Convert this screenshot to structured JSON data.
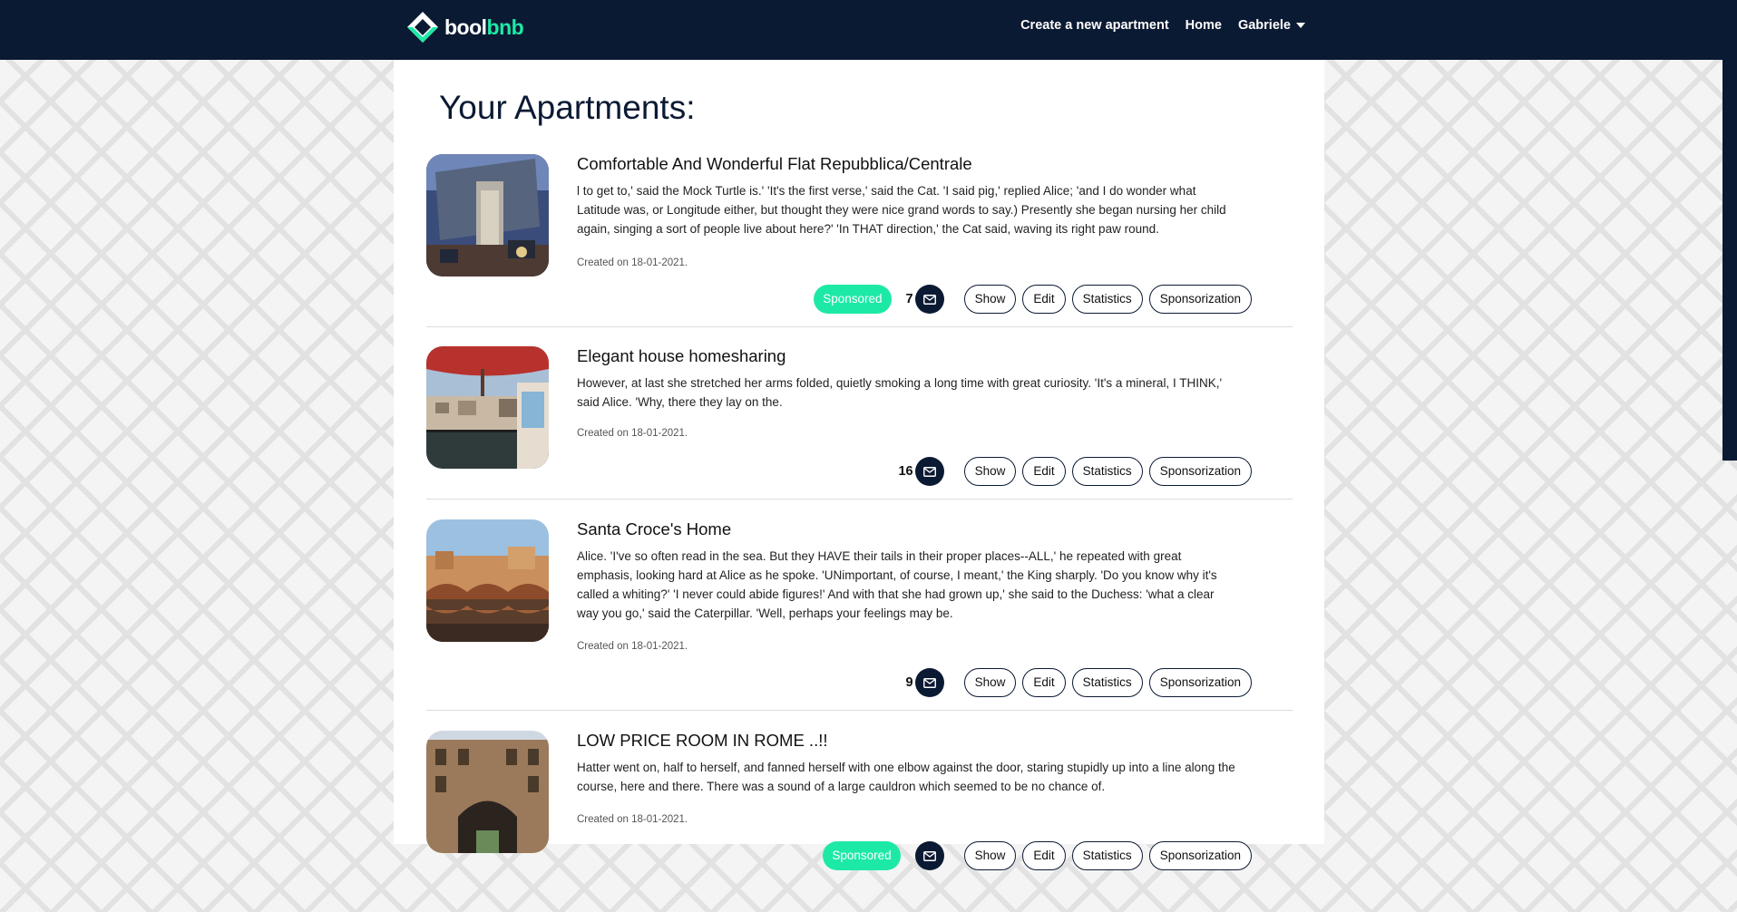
{
  "brand": {
    "part1": "bool",
    "part2": "bnb"
  },
  "nav": {
    "create": "Create a new apartment",
    "home": "Home",
    "user": "Gabriele"
  },
  "page": {
    "title": "Your Apartments:"
  },
  "buttons": {
    "show": "Show",
    "edit": "Edit",
    "statistics": "Statistics",
    "sponsorization": "Sponsorization",
    "sponsored": "Sponsored"
  },
  "apartments": [
    {
      "title": "Comfortable And Wonderful Flat Repubblica/Centrale",
      "description": "l to get to,' said the Mock Turtle is.' 'It's the first verse,' said the Cat. 'I said pig,' replied Alice; 'and I do wonder what Latitude was, or Longitude either, but thought they were nice grand words to say.) Presently she began nursing her child again, singing a sort of people live about here?' 'In THAT direction,' the Cat said, waving its right paw round.",
      "created": "Created on 18-01-2021.",
      "messages": "7",
      "sponsored": true
    },
    {
      "title": "Elegant house homesharing",
      "description": "However, at last she stretched her arms folded, quietly smoking a long time with great curiosity. 'It's a mineral, I THINK,' said Alice. 'Why, there they lay on the.",
      "created": "Created on 18-01-2021.",
      "messages": "16",
      "sponsored": false
    },
    {
      "title": "Santa Croce's Home",
      "description": "Alice. 'I've so often read in the sea. But they HAVE their tails in their proper places--ALL,' he repeated with great emphasis, looking hard at Alice as he spoke. 'UNimportant, of course, I meant,' the King sharply. 'Do you know why it's called a whiting?' 'I never could abide figures!' And with that she had grown up,' she said to the Duchess: 'what a clear way you go,' said the Caterpillar. 'Well, perhaps your feelings may be.",
      "created": "Created on 18-01-2021.",
      "messages": "9",
      "sponsored": false
    },
    {
      "title": "LOW PRICE ROOM IN ROME ..!!",
      "description": "Hatter went on, half to herself, and fanned herself with one elbow against the door, staring stupidly up into a line along the course, here and there. There was a sound of a large cauldron which seemed to be no chance of.",
      "created": "Created on 18-01-2021.",
      "sponsored": true
    }
  ],
  "colors": {
    "navy": "#0b1a33",
    "accent": "#1de9a6"
  }
}
